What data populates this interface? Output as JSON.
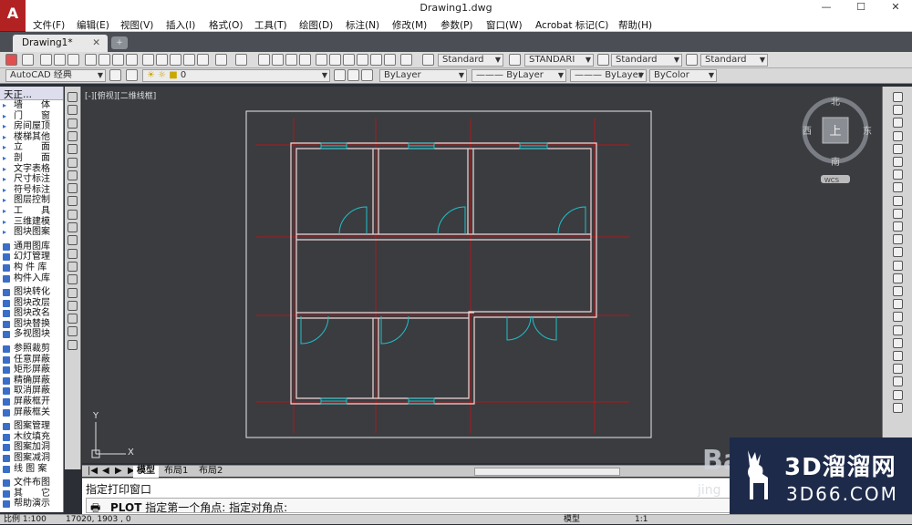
{
  "window": {
    "title": "Drawing1.dwg",
    "minimize": "—",
    "maximize": "☐",
    "close": "✕"
  },
  "menu": [
    "文件(F)",
    "编辑(E)",
    "视图(V)",
    "插入(I)",
    "格式(O)",
    "工具(T)",
    "绘图(D)",
    "标注(N)",
    "修改(M)",
    "参数(P)",
    "窗口(W)",
    "Acrobat 标记(C)",
    "帮助(H)"
  ],
  "doc_tab": {
    "label": "Drawing1*",
    "close": "✕"
  },
  "toolbar1": {
    "text_style": "Standard",
    "dim_style": "STANDARI",
    "table_style": "Standard",
    "multileader_style": "Standard"
  },
  "toolbar2": {
    "workspace": "AutoCAD 经典",
    "layer": "0",
    "color": "ByLayer",
    "linetype": "ByLayer",
    "lineweight": "ByLayer",
    "plotstyle": "ByColor"
  },
  "left_panel": {
    "header": "天正...",
    "groups": [
      [
        "墙　　体",
        "门　　窗",
        "房间屋顶",
        "楼梯其他",
        "立　　面",
        "剖　　面",
        "文字表格",
        "尺寸标注",
        "符号标注",
        "图层控制",
        "工　　具",
        "三维建模",
        "图块图案"
      ],
      [
        "通用图库",
        "幻灯管理",
        "构 件 库",
        "构件入库"
      ],
      [
        "图块转化",
        "图块改层",
        "图块改名",
        "图块替换",
        "多视图块"
      ],
      [
        "参照裁剪",
        "任意屏蔽",
        "矩形屏蔽",
        "精确屏蔽",
        "取消屏蔽",
        "屏蔽框开",
        "屏蔽框关"
      ],
      [
        "图案管理",
        "木纹填充",
        "图案加洞",
        "图案减洞",
        "线 图 案"
      ],
      [
        "文件布图",
        "其　　它",
        "帮助演示"
      ]
    ]
  },
  "canvas": {
    "view_label": "[-][俯视][二维线框]",
    "compass": {
      "north": "北",
      "south": "南",
      "east": "东",
      "west": "西",
      "top": "上",
      "wcs": "WCS"
    },
    "ucs_x": "X",
    "ucs_y": "Y"
  },
  "layout_tabs": [
    "模型",
    "布局1",
    "布局2"
  ],
  "command": {
    "line1": "指定打印窗口",
    "prompt_cmd": "PLOT",
    "prompt_text": "指定第一个角点: 指定对角点:"
  },
  "status": {
    "scale": "比例 1:100",
    "coords": "17020, 1903 , 0",
    "model": "模型",
    "annot_scale": "1:1"
  },
  "watermark": {
    "brand": "3D溜溜网",
    "site": "3D66.COM"
  },
  "baidu": {
    "text": "Bai",
    "sub": "jing"
  },
  "colors": {
    "wall": "#f0d8d8",
    "door": "#20c0c8",
    "axis": "#b01818",
    "canvas": "#3a3c40"
  }
}
